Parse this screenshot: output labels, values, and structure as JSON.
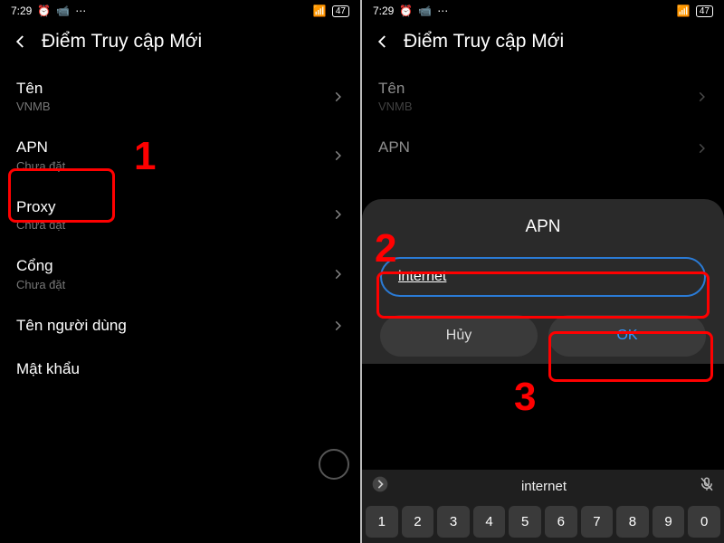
{
  "status": {
    "time": "7:29",
    "battery": "47"
  },
  "header": {
    "title": "Điểm Truy cập Mới"
  },
  "settings": {
    "name_label": "Tên",
    "name_value": "VNMB",
    "apn_label": "APN",
    "apn_value": "Chưa đặt",
    "proxy_label": "Proxy",
    "proxy_value": "Chưa đặt",
    "port_label": "Cổng",
    "port_value": "Chưa đặt",
    "user_label": "Tên người dùng",
    "password_label": "Mật khẩu"
  },
  "dialog": {
    "title": "APN",
    "input_value": "internet",
    "cancel_label": "Hủy",
    "ok_label": "OK"
  },
  "keyboard": {
    "suggestion": "internet",
    "digits": [
      "1",
      "2",
      "3",
      "4",
      "5",
      "6",
      "7",
      "8",
      "9",
      "0"
    ]
  },
  "annotations": {
    "one": "1",
    "two": "2",
    "three": "3"
  }
}
